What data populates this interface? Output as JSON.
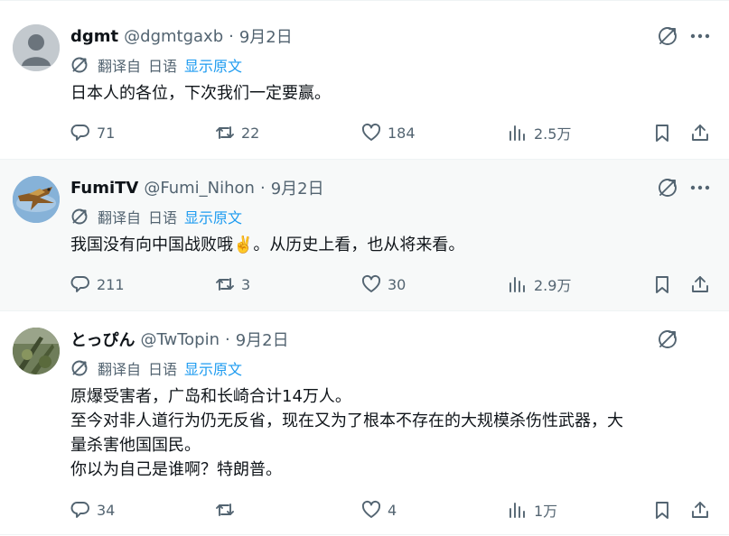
{
  "posts": [
    {
      "name": "dgmt",
      "handle": "@dgmtgaxb",
      "dot": "·",
      "date": "9月2日",
      "avatar": "default-avatar",
      "translate": {
        "label": "翻译自",
        "lang": "日语",
        "show": "显示原文"
      },
      "lines": [
        "日本人的各位，下次我们一定要赢。"
      ],
      "stats": {
        "replies": "71",
        "reposts": "22",
        "likes": "184",
        "views": "2.5万"
      }
    },
    {
      "name": "FumiTV",
      "handle": "@Fumi_Nihon",
      "dot": "·",
      "date": "9月2日",
      "avatar": "bird-avatar",
      "translate": {
        "label": "翻译自",
        "lang": "日语",
        "show": "显示原文"
      },
      "lines": [
        "我国没有向中国战败哦✌️。从历史上看，也从将来看。"
      ],
      "stats": {
        "replies": "211",
        "reposts": "3",
        "likes": "30",
        "views": "2.9万"
      }
    },
    {
      "name": "とっぴん",
      "handle": "@TwTopin",
      "dot": "·",
      "date": "9月2日",
      "avatar": "plant-avatar",
      "translate": {
        "label": "翻译自",
        "lang": "日语",
        "show": "显示原文"
      },
      "lines": [
        "原爆受害者，广岛和长崎合计14万人。",
        "至今对非人道行为仍无反省，现在又为了根本不存在的大规模杀伤性武器，大",
        "量杀害他国国民。",
        "你以为自己是谁啊？特朗普。"
      ],
      "stats": {
        "replies": "34",
        "reposts": "",
        "likes": "4",
        "views": "1万"
      }
    }
  ],
  "icons": {
    "translate": "translate-icon",
    "more": "more-icon",
    "reply": "reply-icon",
    "repost": "repost-icon",
    "like": "like-icon",
    "views": "views-icon",
    "bookmark": "bookmark-icon",
    "share": "share-icon"
  },
  "colors": {
    "text": "#0f1419",
    "muted": "#536471",
    "link": "#1d9bf0",
    "highlight_bg": "#f7f9f9",
    "divider": "#eff3f4"
  }
}
